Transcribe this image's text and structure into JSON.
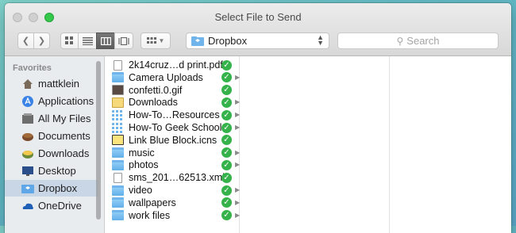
{
  "window": {
    "title": "Select File to Send"
  },
  "toolbar": {
    "back_label": "<",
    "forward_label": ">",
    "location": "Dropbox",
    "search_placeholder": "Search"
  },
  "sidebar": {
    "header": "Favorites",
    "items": [
      {
        "label": "mattklein",
        "icon": "home-icon"
      },
      {
        "label": "Applications",
        "icon": "applications-icon"
      },
      {
        "label": "All My Files",
        "icon": "all-files-icon"
      },
      {
        "label": "Documents",
        "icon": "documents-icon"
      },
      {
        "label": "Downloads",
        "icon": "downloads-icon"
      },
      {
        "label": "Desktop",
        "icon": "desktop-icon"
      },
      {
        "label": "Dropbox",
        "icon": "dropbox-icon",
        "selected": true
      },
      {
        "label": "OneDrive",
        "icon": "onedrive-icon"
      }
    ]
  },
  "files": [
    {
      "name": "2k14cruz…d print.pdf",
      "type": "doc",
      "folder": false
    },
    {
      "name": "Camera Uploads",
      "type": "folder",
      "folder": true
    },
    {
      "name": "confetti.0.gif",
      "type": "img",
      "folder": false
    },
    {
      "name": "Downloads",
      "type": "dl",
      "folder": true
    },
    {
      "name": "How-To…Resources",
      "type": "grid",
      "folder": true
    },
    {
      "name": "How-To Geek School",
      "type": "grid",
      "folder": true
    },
    {
      "name": "Link Blue Block.icns",
      "type": "icns",
      "folder": false
    },
    {
      "name": "music",
      "type": "folder",
      "folder": true
    },
    {
      "name": "photos",
      "type": "folder",
      "folder": true
    },
    {
      "name": "sms_201…62513.xml",
      "type": "doc",
      "folder": false
    },
    {
      "name": "video",
      "type": "folder",
      "folder": true
    },
    {
      "name": "wallpapers",
      "type": "folder",
      "folder": true
    },
    {
      "name": "work files",
      "type": "folder",
      "folder": true
    }
  ],
  "colors": {
    "sync_check": "#35b34a",
    "selection": "#c8d6e6",
    "accent_folder": "#62aee8"
  }
}
